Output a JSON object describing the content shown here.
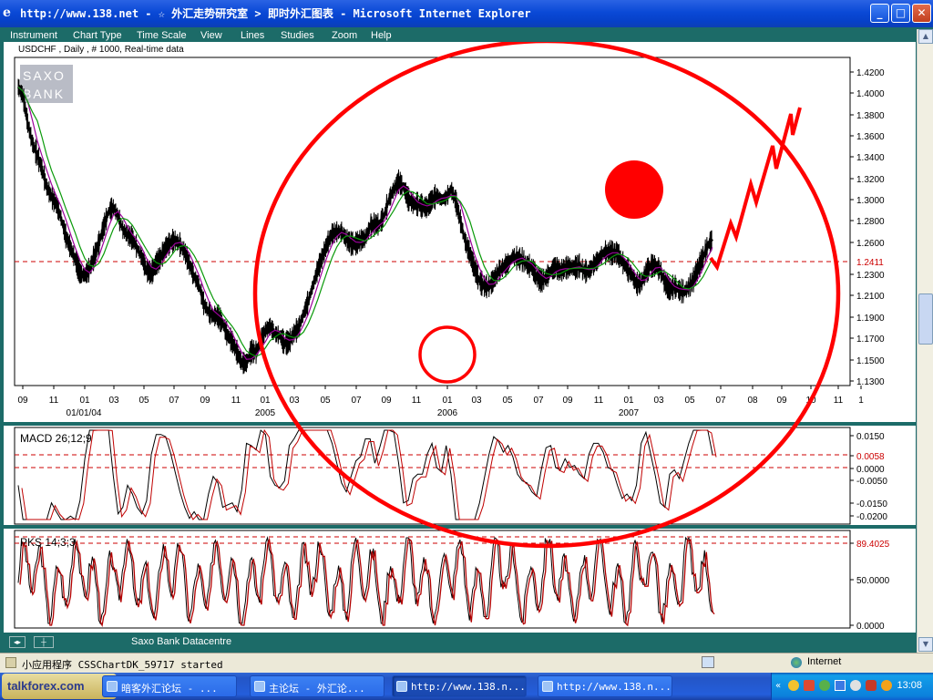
{
  "window": {
    "title": "http://www.138.net - ☆ 外汇走势研究室 > 即时外汇图表 - Microsoft Internet Explorer",
    "controls": [
      "minimize",
      "maximize",
      "close"
    ]
  },
  "menu": [
    "Instrument",
    "Chart Type",
    "Time Scale",
    "View",
    "Lines",
    "Studies",
    "Zoom",
    "Help"
  ],
  "chart": {
    "header": "USDCHF , Daily , # 1000, Real-time data",
    "watermark": [
      "SAXO",
      "BANK"
    ]
  },
  "chart_data": [
    {
      "type": "line",
      "panel": "price",
      "title": "USDCHF , Daily , # 1000, Real-time data",
      "yticks": [
        1.42,
        1.4,
        1.38,
        1.36,
        1.34,
        1.32,
        1.3,
        1.28,
        1.26,
        1.23,
        1.21,
        1.19,
        1.17,
        1.15,
        1.13
      ],
      "ytick_labels": [
        "1.4200",
        "1.4000",
        "1.3800",
        "1.3600",
        "1.3400",
        "1.3200",
        "1.3000",
        "1.2800",
        "1.2600",
        "1.2300",
        "1.2100",
        "1.1900",
        "1.1700",
        "1.1500",
        "1.1300"
      ],
      "current_value": 1.2411,
      "current_label": "1.2411",
      "xticks_month": [
        "09",
        "11",
        "01",
        "03",
        "05",
        "07",
        "09",
        "11",
        "01",
        "03",
        "05",
        "07",
        "09",
        "11",
        "01",
        "03",
        "05",
        "07",
        "09",
        "11",
        "01",
        "03",
        "05",
        "07",
        "08",
        "09",
        "10",
        "11",
        "1"
      ],
      "xticks_year": [
        "01/01/04",
        "2005",
        "2006",
        "2007"
      ],
      "series": [
        {
          "name": "USDCHF close",
          "color": "#000000",
          "values": [
            1.406,
            1.398,
            1.372,
            1.353,
            1.342,
            1.329,
            1.312,
            1.303,
            1.296,
            1.283,
            1.266,
            1.255,
            1.244,
            1.231,
            1.229,
            1.235,
            1.247,
            1.26,
            1.275,
            1.289,
            1.293,
            1.285,
            1.272,
            1.267,
            1.264,
            1.255,
            1.246,
            1.234,
            1.231,
            1.24,
            1.246,
            1.255,
            1.26,
            1.262,
            1.258,
            1.251,
            1.24,
            1.228,
            1.22,
            1.203,
            1.195,
            1.191,
            1.191,
            1.184,
            1.173,
            1.167,
            1.157,
            1.147,
            1.147,
            1.158,
            1.157,
            1.166,
            1.178,
            1.181,
            1.174,
            1.173,
            1.165,
            1.167,
            1.175,
            1.18,
            1.193,
            1.205,
            1.22,
            1.235,
            1.247,
            1.259,
            1.268,
            1.27,
            1.27,
            1.263,
            1.259,
            1.259,
            1.262,
            1.264,
            1.275,
            1.277,
            1.277,
            1.286,
            1.301,
            1.31,
            1.317,
            1.312,
            1.301,
            1.297,
            1.296,
            1.294,
            1.293,
            1.3,
            1.304,
            1.3,
            1.302,
            1.31,
            1.299,
            1.28,
            1.261,
            1.249,
            1.235,
            1.224,
            1.219,
            1.219,
            1.225,
            1.233,
            1.237,
            1.24,
            1.247,
            1.245,
            1.244,
            1.239,
            1.237,
            1.228,
            1.224,
            1.227,
            1.233,
            1.237,
            1.233,
            1.236,
            1.237,
            1.236,
            1.238,
            1.233,
            1.233,
            1.239,
            1.244,
            1.25,
            1.251,
            1.25,
            1.25,
            1.242,
            1.236,
            1.23,
            1.221,
            1.222,
            1.232,
            1.238,
            1.238,
            1.234,
            1.222,
            1.216,
            1.219,
            1.215,
            1.214,
            1.218,
            1.225,
            1.236,
            1.246,
            1.257,
            1.263
          ]
        },
        {
          "name": "MA short",
          "color": "#9b009b"
        },
        {
          "name": "MA long",
          "color": "#0a9a0a"
        }
      ],
      "projection": "hand-drawn red arrow rising from 1.2411 toward ~1.38 by 10/2007"
    },
    {
      "type": "line",
      "panel": "MACD",
      "title": "MACD 26;12;9",
      "current_label": "0.0058",
      "ytick_labels": [
        "0.0150",
        "0.0058",
        "0.0000",
        "-0.0050",
        "-0.0150",
        "-0.0200"
      ]
    },
    {
      "type": "line",
      "panel": "stochastic",
      "title": "PKS 14;3;3",
      "current_label": "89.4025",
      "ytick_labels": [
        "89.4025",
        "50.0000",
        "0.0000"
      ]
    }
  ],
  "applet_status": "Saxo Bank Datacentre",
  "status": {
    "text": "小应用程序 CSSChartDK_59717 started",
    "zone": "Internet"
  },
  "taskbar": {
    "tasks": [
      "暗客外汇论坛 - ...",
      "主论坛 - 外汇论...",
      "http://www.138.n...",
      "http://www.138.n..."
    ],
    "clock": "13:08",
    "logo": "talkforex.com"
  },
  "colors": {
    "price": "#000000",
    "ma_fast": "#9b009b",
    "ma_slow": "#0a9a0a",
    "annotation": "#ff0000",
    "panel_bg": "#1c6b68"
  }
}
